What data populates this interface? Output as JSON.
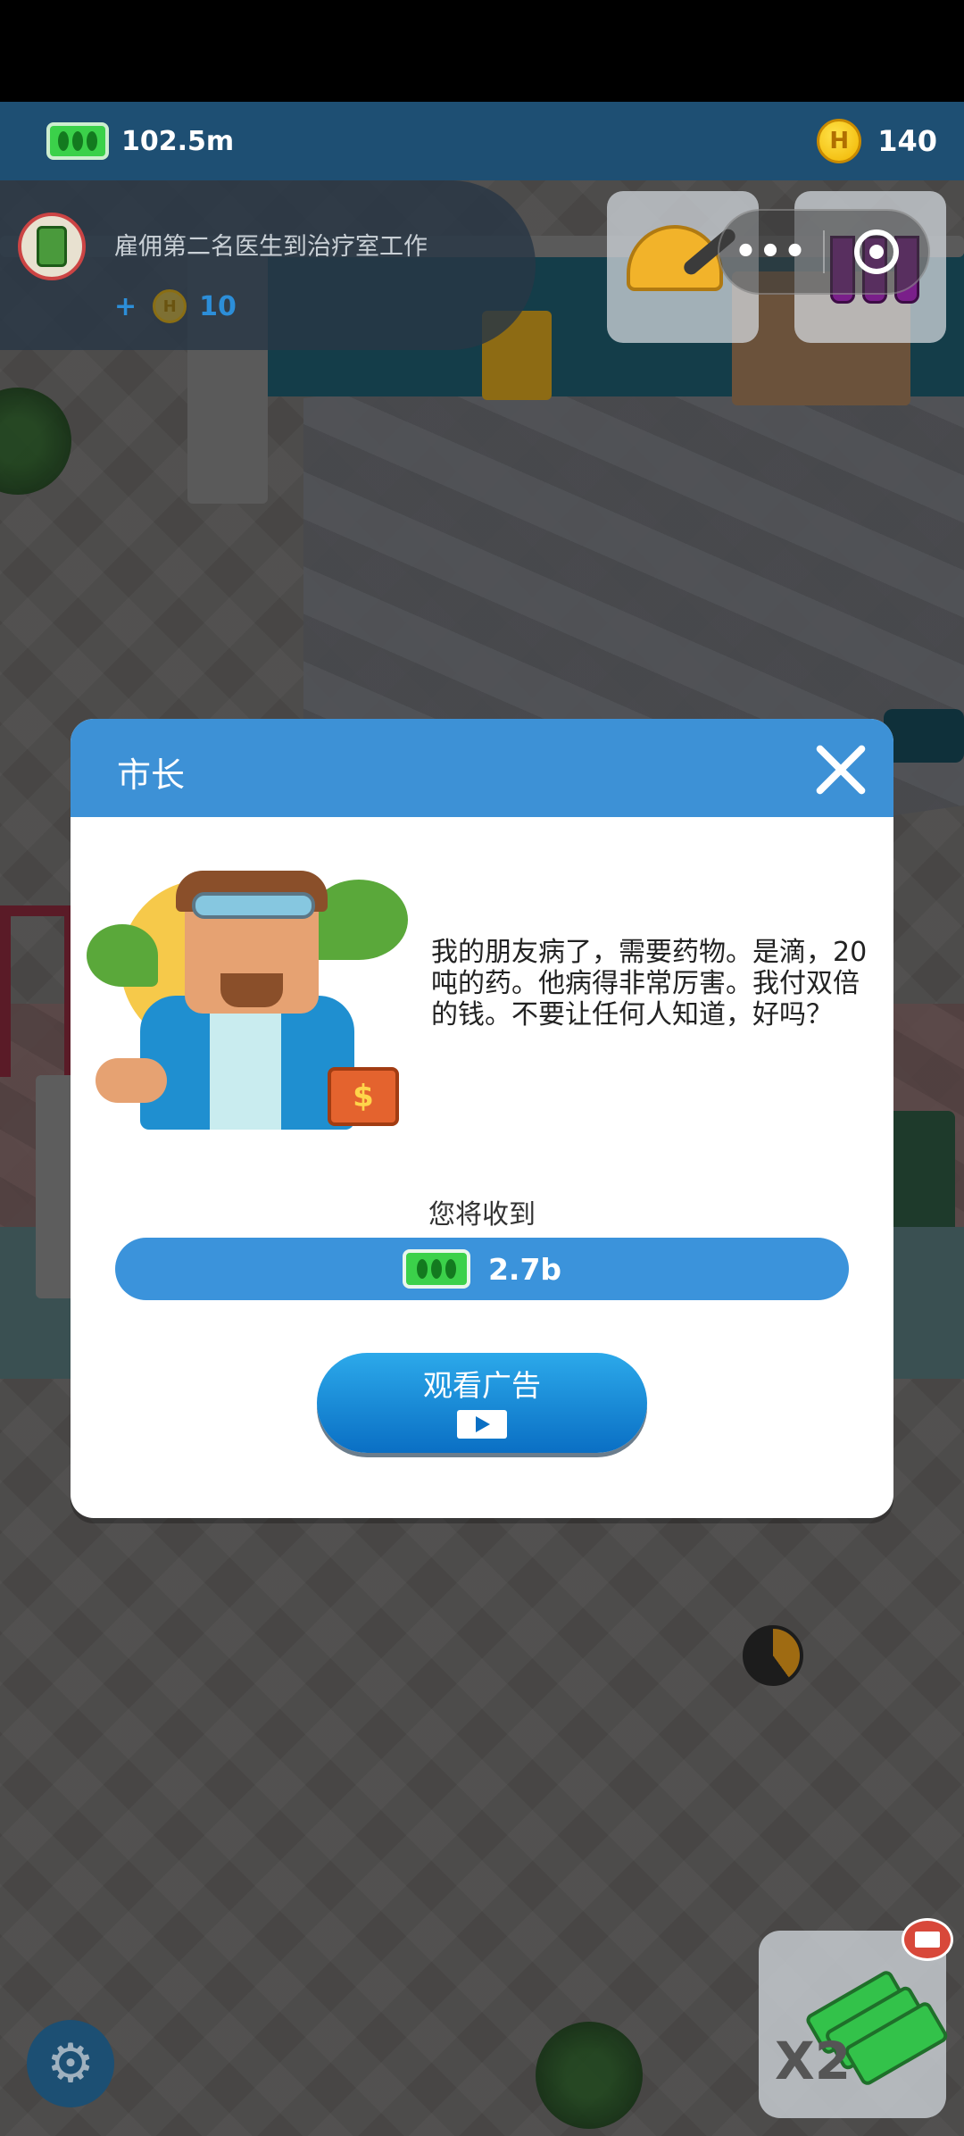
{
  "hud": {
    "cash": "102.5m",
    "coin_symbol": "H",
    "coins": "140"
  },
  "quest": {
    "text": "雇佣第二名医生到治疗室工作",
    "plus": "+",
    "coin_symbol": "H",
    "reward": "10"
  },
  "capsule": {
    "more": "•••"
  },
  "modal": {
    "title": "市长",
    "message": "我的朋友病了，需要药物。是滴，20吨的药。他病得非常厉害。我付双倍的钱。不要让任何人知道，好吗？",
    "case_symbol": "$",
    "receive_label": "您将收到",
    "reward": "2.7b",
    "watch_ad_label": "观看广告"
  },
  "boost": {
    "label": "X2"
  },
  "icons": {
    "cash": "cash-icon",
    "coin": "coin-icon",
    "settings": "gear-icon",
    "close": "close-icon",
    "video": "video-icon"
  },
  "colors": {
    "hud_bar": "#1e4f73",
    "modal_header": "#3d91d6",
    "reward_bar": "#3b93db",
    "cash_green": "#3bd14a",
    "coin_gold": "#f0b400"
  }
}
